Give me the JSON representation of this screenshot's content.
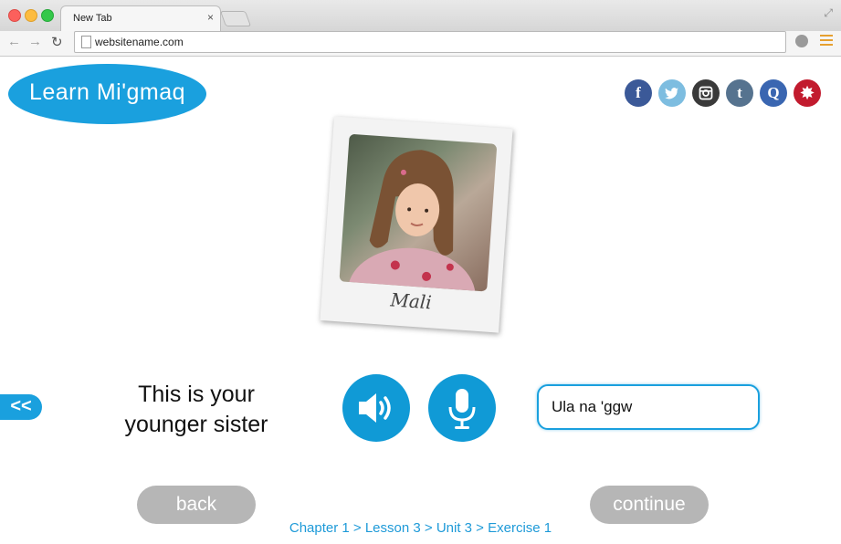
{
  "browser": {
    "tab_title": "New Tab",
    "tab_close": "×",
    "url": "websitename.com"
  },
  "logo": {
    "text": "Learn Mi'gmaq"
  },
  "social": [
    "f",
    "twitter",
    "instagram",
    "t",
    "Q",
    "star"
  ],
  "card": {
    "caption": "Mali"
  },
  "nav": {
    "prev_arrow": "<<"
  },
  "prompt": {
    "text_line1": "This is your",
    "text_line2": "younger sister"
  },
  "answer": {
    "value": "Ula na 'ggw"
  },
  "buttons": {
    "back": "back",
    "continue": "continue"
  },
  "breadcrumb": "Chapter 1 > Lesson 3 > Unit 3 > Exercise 1",
  "colors": {
    "accent": "#1aa0de",
    "button_gray": "#b6b6b6"
  }
}
